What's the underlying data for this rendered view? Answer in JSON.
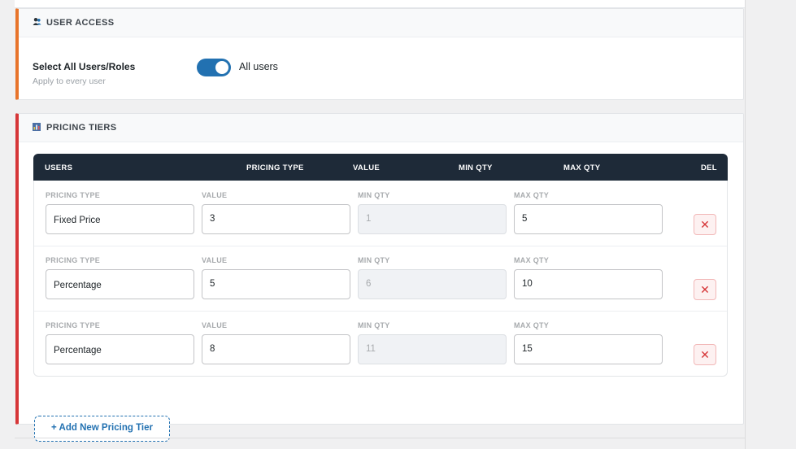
{
  "user_access": {
    "icon": "users-icon",
    "heading": "USER ACCESS",
    "select_all_title": "Select All Users/Roles",
    "select_all_sub": "Apply to every user",
    "toggle_on": true,
    "toggle_label": "All users"
  },
  "pricing_tiers": {
    "icon": "chart-icon",
    "heading": "PRICING TIERS",
    "columns": [
      "USERS",
      "PRICING TYPE",
      "VALUE",
      "MIN QTY",
      "MAX QTY",
      "DEL"
    ],
    "field_labels": {
      "pricing_type": "PRICING TYPE",
      "value": "VALUE",
      "min_qty": "MIN QTY",
      "max_qty": "MAX QTY"
    },
    "rows": [
      {
        "pricing_type": "Fixed Price",
        "value": "3",
        "min_qty": "1",
        "max_qty": "5"
      },
      {
        "pricing_type": "Percentage",
        "value": "5",
        "min_qty": "6",
        "max_qty": "10"
      },
      {
        "pricing_type": "Percentage",
        "value": "8",
        "min_qty": "11",
        "max_qty": "15"
      }
    ],
    "delete_glyph": "✕",
    "add_button_label": "+ Add New Pricing Tier"
  },
  "colors": {
    "access_accent": "#e8742b",
    "tiers_accent": "#d63638",
    "table_header": "#1e2a38",
    "primary": "#2271b1"
  }
}
